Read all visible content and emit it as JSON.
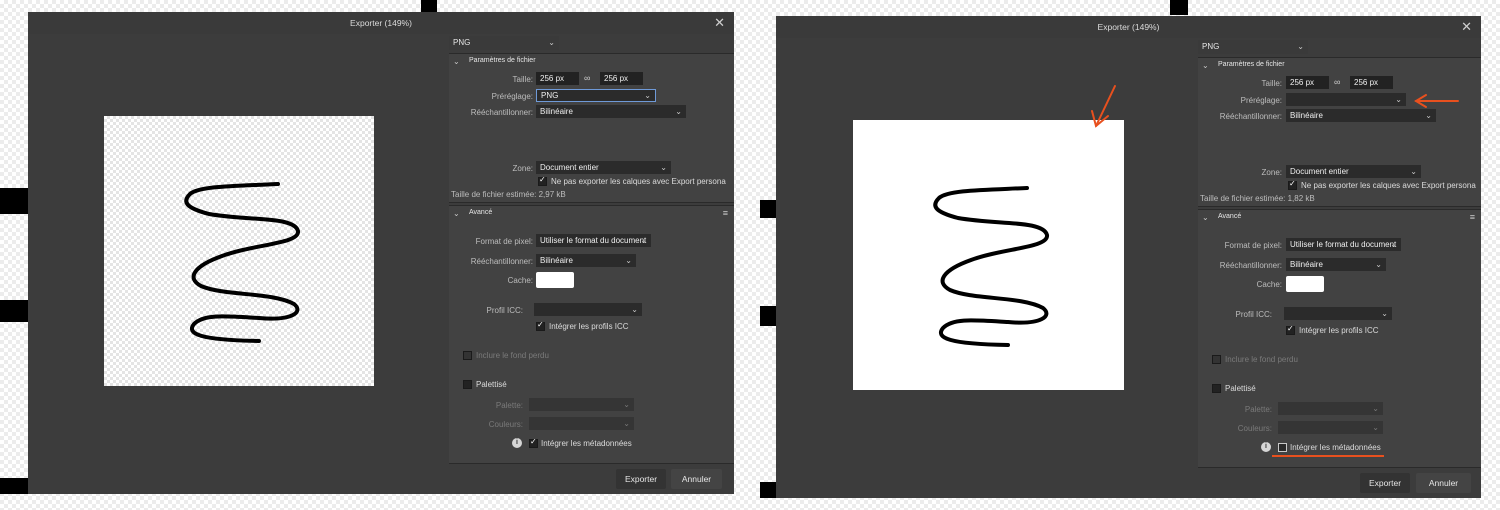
{
  "dialogs": [
    {
      "title": "Exporter (149%)",
      "format": "PNG",
      "file_settings_header": "Paramètres de fichier",
      "size_label": "Taille:",
      "width": "256 px",
      "height": "256 px",
      "preset_label": "Préréglage:",
      "preset_value": "PNG",
      "resample_label": "Rééchantillonner:",
      "resample_value": "Bilinéaire",
      "zone_label": "Zone:",
      "zone_value": "Document entier",
      "no_export_persona": "Ne pas exporter les calques avec Export persona",
      "estimated_size": "Taille de fichier estimée: 2,97 kB",
      "advanced_header": "Avancé",
      "pixel_format_label": "Format de pixel:",
      "pixel_format_value": "Utiliser le format du document",
      "resample2_label": "Rééchantillonner:",
      "resample2_value": "Bilinéaire",
      "matte_label": "Cache:",
      "icc_label": "Profil ICC:",
      "icc_value": "",
      "embed_icc": "Intégrer les profils ICC",
      "include_bleed": "Inclure le fond perdu",
      "palettised": "Palettisé",
      "palette_label": "Palette:",
      "colors_label": "Couleurs:",
      "embed_metadata": "Intégrer les métadonnées",
      "export_button": "Exporter",
      "cancel_button": "Annuler",
      "preview_background": "transparent",
      "embed_metadata_checked": true
    },
    {
      "title": "Exporter (149%)",
      "format": "PNG",
      "file_settings_header": "Paramètres de fichier",
      "size_label": "Taille:",
      "width": "256 px",
      "height": "256 px",
      "preset_label": "Préréglage:",
      "preset_value": "",
      "resample_label": "Rééchantillonner:",
      "resample_value": "Bilinéaire",
      "zone_label": "Zone:",
      "zone_value": "Document entier",
      "no_export_persona": "Ne pas exporter les calques avec Export persona",
      "estimated_size": "Taille de fichier estimée: 1,82 kB",
      "advanced_header": "Avancé",
      "pixel_format_label": "Format de pixel:",
      "pixel_format_value": "Utiliser le format du document",
      "resample2_label": "Rééchantillonner:",
      "resample2_value": "Bilinéaire",
      "matte_label": "Cache:",
      "icc_label": "Profil ICC:",
      "icc_value": "",
      "embed_icc": "Intégrer les profils ICC",
      "include_bleed": "Inclure le fond perdu",
      "palettised": "Palettisé",
      "palette_label": "Palette:",
      "colors_label": "Couleurs:",
      "embed_metadata": "Intégrer les métadonnées",
      "export_button": "Exporter",
      "cancel_button": "Annuler",
      "preview_background": "white",
      "embed_metadata_checked": false
    }
  ],
  "icons": {
    "close": "close-icon",
    "chevron": "chevron-down-icon",
    "link": "link-icon",
    "menu": "hamburger-menu-icon",
    "info": "info-icon",
    "check": "check-icon"
  },
  "colors": {
    "dialog_bg": "#3c3c3c",
    "panel_bg": "#424242",
    "input_bg": "#222222",
    "annotation": "#e8501e",
    "accent": "#6f9ad8"
  }
}
